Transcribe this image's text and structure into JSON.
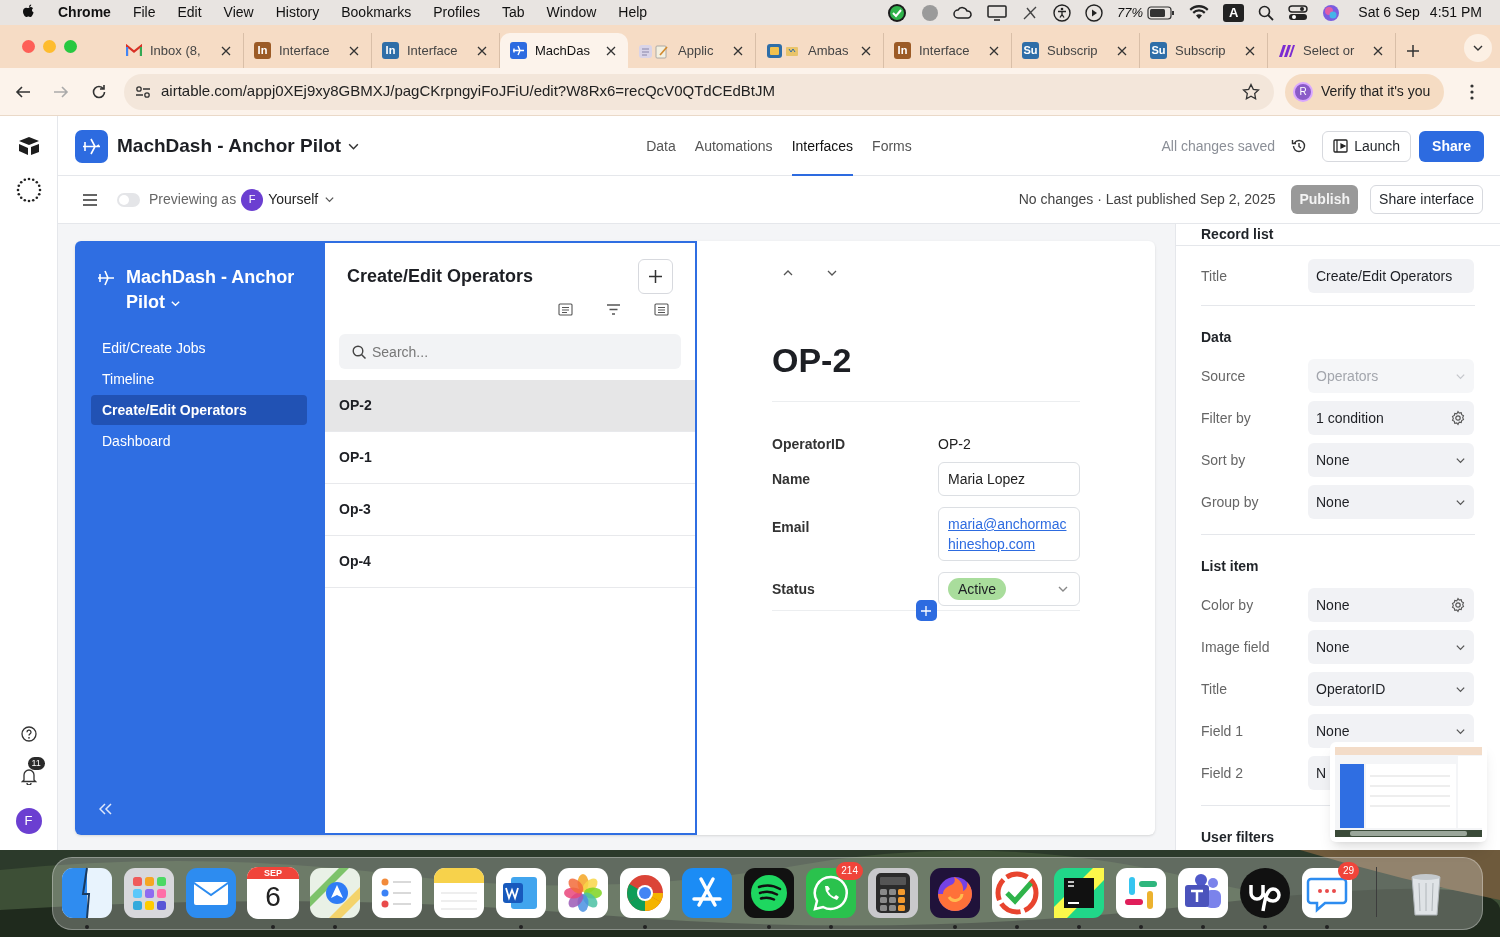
{
  "menubar": {
    "app": "Chrome",
    "menus": [
      "File",
      "Edit",
      "View",
      "History",
      "Bookmarks",
      "Profiles",
      "Tab",
      "Window",
      "Help"
    ],
    "battery": "77%",
    "input_source": "A",
    "date": "Sat 6 Sep",
    "time": "4:51 PM"
  },
  "browser": {
    "tabs": [
      {
        "label": "Inbox (8,",
        "kind": "gmail",
        "selected": false
      },
      {
        "label": "Interface",
        "kind": "letters",
        "favicon_text": "In",
        "color": "#9c5b26",
        "selected": false
      },
      {
        "label": "Interface",
        "kind": "letters",
        "favicon_text": "In",
        "color": "#2f6ea8",
        "selected": false
      },
      {
        "label": "MachDas",
        "kind": "app",
        "selected": true
      },
      {
        "label": "Applic",
        "kind": "note",
        "selected": false
      },
      {
        "label": "Ambas",
        "selected": false
      },
      {
        "label": "Interface",
        "kind": "letters",
        "favicon_text": "In",
        "color": "#9c5b26",
        "selected": false
      },
      {
        "label": "Subscrip",
        "kind": "letters",
        "favicon_text": "Su",
        "color": "#2f6ea8",
        "selected": false
      },
      {
        "label": "Subscrip",
        "kind": "letters",
        "favicon_text": "Su",
        "color": "#2f6ea8",
        "selected": false
      },
      {
        "label": "Select or",
        "kind": "stripes",
        "selected": false
      }
    ],
    "url": "airtable.com/appj0XEj9xy8GBMXJ/pagCKrpngyiFoJFiU/edit?W8Rx6=recQcV0QTdCEdBtJM",
    "profile": {
      "avatar": "R",
      "label": "Verify that it's you"
    }
  },
  "rail": {
    "notifications": "11",
    "avatar": "F"
  },
  "header": {
    "title": "MachDash - Anchor Pilot",
    "nav": [
      {
        "label": "Data",
        "selected": false
      },
      {
        "label": "Automations",
        "selected": false
      },
      {
        "label": "Interfaces",
        "selected": true
      },
      {
        "label": "Forms",
        "selected": false
      }
    ],
    "save_status": "All changes saved",
    "launch": "Launch",
    "share": "Share"
  },
  "preview": {
    "toggle_on": false,
    "label": "Previewing as",
    "avatar": "F",
    "user": "Yourself",
    "status": "No changes · Last published Sep 2, 2025",
    "publish": {
      "label": "Publish",
      "disabled": true
    },
    "share_interface": "Share interface"
  },
  "interface": {
    "title": "MachDash - Anchor Pilot",
    "pages": [
      {
        "label": "Edit/Create Jobs",
        "selected": false
      },
      {
        "label": "Timeline",
        "selected": false
      },
      {
        "label": "Create/Edit Operators",
        "selected": true
      },
      {
        "label": "Dashboard",
        "selected": false
      }
    ]
  },
  "list": {
    "title": "Create/Edit Operators",
    "search_placeholder": "Search...",
    "records": [
      {
        "label": "OP-2",
        "selected": true
      },
      {
        "label": "OP-1",
        "selected": false
      },
      {
        "label": "Op-3",
        "selected": false
      },
      {
        "label": "Op-4",
        "selected": false
      }
    ]
  },
  "record": {
    "title": "OP-2",
    "fields": [
      {
        "label": "OperatorID",
        "value": "OP-2",
        "kind": "text"
      },
      {
        "label": "Name",
        "value": "Maria Lopez",
        "kind": "input"
      },
      {
        "label": "Email",
        "value": "maria@anchormachineshop.com",
        "kind": "link"
      },
      {
        "label": "Status",
        "value": "Active",
        "kind": "select",
        "color": "#a9dd9c"
      }
    ]
  },
  "properties": {
    "title": "Record list",
    "title_row": {
      "label": "Title",
      "value": "Create/Edit Operators"
    },
    "sections": [
      {
        "heading": "Data",
        "rows": [
          {
            "label": "Source",
            "value": "Operators",
            "kind": "select",
            "disabled": true
          },
          {
            "label": "Filter by",
            "value": "1 condition",
            "kind": "gear",
            "disabled": false
          },
          {
            "label": "Sort by",
            "value": "None",
            "kind": "select",
            "disabled": false
          },
          {
            "label": "Group by",
            "value": "None",
            "kind": "select",
            "disabled": false
          }
        ]
      },
      {
        "heading": "List item",
        "rows": [
          {
            "label": "Color by",
            "value": "None",
            "kind": "gear",
            "disabled": false
          },
          {
            "label": "Image field",
            "value": "None",
            "kind": "select",
            "disabled": false
          },
          {
            "label": "Title",
            "value": "OperatorID",
            "kind": "select",
            "disabled": false
          },
          {
            "label": "Field 1",
            "value": "None",
            "kind": "select",
            "disabled": false
          },
          {
            "label": "Field 2",
            "value": "N",
            "kind": "select",
            "disabled": false
          }
        ]
      },
      {
        "heading": "User filters"
      }
    ]
  },
  "dock": {
    "items": [
      {
        "kind": "finder",
        "running": true
      },
      {
        "kind": "launchpad",
        "running": false
      },
      {
        "kind": "mail",
        "running": false
      },
      {
        "kind": "calendar",
        "month": "SEP",
        "day": "6",
        "running": true
      },
      {
        "kind": "maps",
        "running": true
      },
      {
        "kind": "reminders",
        "running": false
      },
      {
        "kind": "notes",
        "running": false
      },
      {
        "kind": "word",
        "running": true
      },
      {
        "kind": "photos",
        "running": false
      },
      {
        "kind": "chrome",
        "running": true
      },
      {
        "kind": "appstore",
        "running": false
      },
      {
        "kind": "spotify",
        "running": true
      },
      {
        "kind": "whatsapp",
        "badge": "214",
        "running": true
      },
      {
        "kind": "calculator",
        "running": false
      },
      {
        "kind": "firefox",
        "running": true
      },
      {
        "kind": "tasks",
        "running": true
      },
      {
        "kind": "pycharm",
        "running": true
      },
      {
        "kind": "slack",
        "running": true
      },
      {
        "kind": "teams",
        "running": true
      },
      {
        "kind": "upwork",
        "running": true
      },
      {
        "kind": "messenger",
        "badge": "29",
        "running": true
      },
      {
        "kind": "separator"
      },
      {
        "kind": "trash",
        "running": false
      }
    ]
  }
}
